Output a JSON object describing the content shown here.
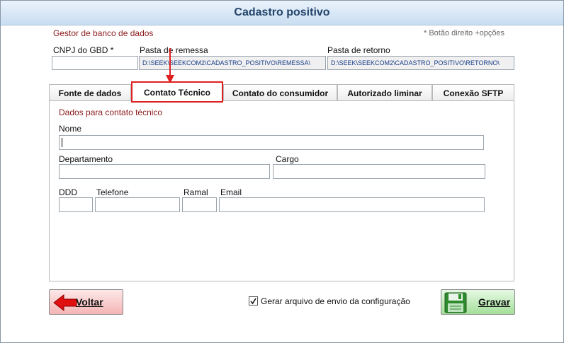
{
  "window": {
    "title": "Cadastro positivo"
  },
  "header": {
    "section_label": "Gestor de banco de dados",
    "hint": "* Botão direito +opções",
    "cnpj_label": "CNPJ do GBD *",
    "cnpj_value": "",
    "remessa_label": "Pasta de remessa",
    "remessa_value": "D:\\SEEK\\SEEKCOM2\\CADASTRO_POSITIVO\\REMESSA\\",
    "retorno_label": "Pasta de retorno",
    "retorno_value": "D:\\SEEK\\SEEKCOM2\\CADASTRO_POSITIVO\\RETORNO\\"
  },
  "tabs": [
    {
      "label": "Fonte de dados",
      "active": false
    },
    {
      "label": "Contato Técnico",
      "active": true
    },
    {
      "label": "Contato do consumidor",
      "active": false
    },
    {
      "label": "Autorizado liminar",
      "active": false
    },
    {
      "label": "Conexão SFTP",
      "active": false
    }
  ],
  "form": {
    "section_label": "Dados para contato técnico",
    "nome_label": "Nome",
    "nome_value": "",
    "departamento_label": "Departamento",
    "departamento_value": "",
    "cargo_label": "Cargo",
    "cargo_value": "",
    "ddd_label": "DDD",
    "ddd_value": "",
    "telefone_label": "Telefone",
    "telefone_value": "",
    "ramal_label": "Ramal",
    "ramal_value": "",
    "email_label": "Email",
    "email_value": ""
  },
  "footer": {
    "voltar_label": "Voltar",
    "checkbox_label": "Gerar arquivo de envio da configuração",
    "checkbox_checked": true,
    "gravar_label": "Gravar"
  },
  "annotation": {
    "arrow_color": "#e02020",
    "highlight_color": "#e02020"
  }
}
